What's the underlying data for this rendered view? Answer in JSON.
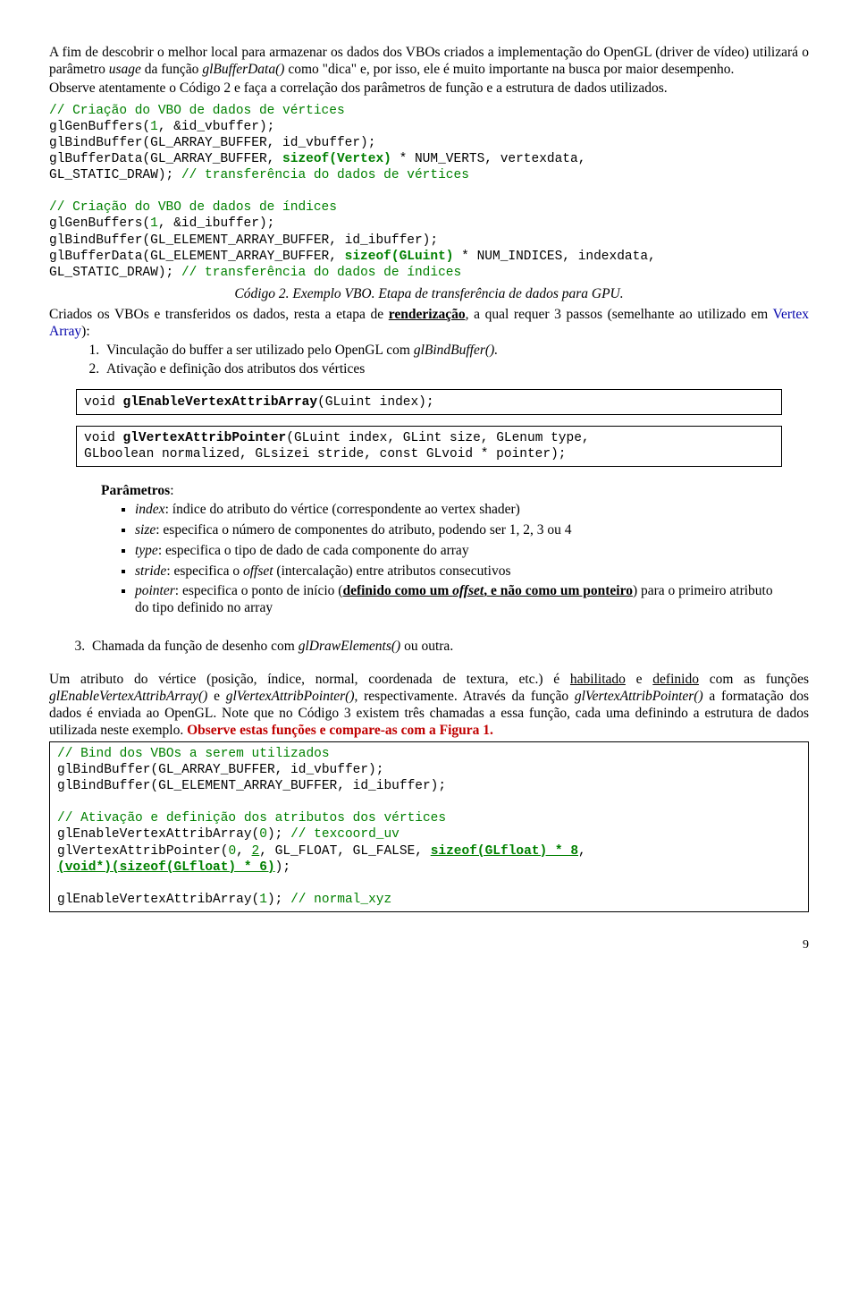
{
  "para1": "A fim de descobrir o melhor local para armazenar os dados dos VBOs criados a implementação do OpenGL (driver de vídeo) utilizará o parâmetro ",
  "para1_i1": "usage",
  "para1_b": " da função ",
  "para1_i2": "glBufferData()",
  "para1_c": " como \"dica\" e, por isso, ele é muito importante na busca por maior desempenho.",
  "para2": "Observe atentamente o Código 2 e faça a correlação dos parâmetros de função e a estrutura de dados utilizados.",
  "code1_l1": "// Criação do VBO de dados de vértices",
  "code1_l2a": "glGenBuffers(",
  "code1_l2b": "1",
  "code1_l2c": ", &id_vbuffer);",
  "code1_l3": "glBindBuffer(GL_ARRAY_BUFFER, id_vbuffer);",
  "code1_l4a": "glBufferData(GL_ARRAY_BUFFER, ",
  "code1_l4b": "sizeof(Vertex)",
  "code1_l4c": " * NUM_VERTS, vertexdata,",
  "code1_l5a": "GL_STATIC_DRAW); ",
  "code1_l5b": "// transferência do dados de vértices",
  "code2_l1": "// Criação do VBO de dados de índices",
  "code2_l2a": "glGenBuffers(",
  "code2_l2b": "1",
  "code2_l2c": ", &id_ibuffer);",
  "code2_l3": "glBindBuffer(GL_ELEMENT_ARRAY_BUFFER, id_ibuffer);",
  "code2_l4a": "glBufferData(GL_ELEMENT_ARRAY_BUFFER, ",
  "code2_l4b": "sizeof(GLuint)",
  "code2_l4c": " * NUM_INDICES, indexdata,",
  "code2_l5a": "GL_STATIC_DRAW); ",
  "code2_l5b": "// transferência do dados de índices",
  "caption1": "Código 2. Exemplo VBO. Etapa de transferência de dados para GPU.",
  "para3a": "Criados os VBOs e transferidos os dados, resta a etapa de ",
  "para3u": "renderização",
  "para3b": ", a qual requer 3 passos (semelhante ao utilizado em ",
  "para3link": "Vertex Array",
  "para3c": "):",
  "li1a": "Vinculação do buffer a ser utilizado pelo OpenGL com ",
  "li1i": "glBindBuffer().",
  "li2": "Ativação e definição dos atributos dos vértices",
  "box1a": "void ",
  "box1b": "glEnableVertexAttribArray",
  "box1c": "(GLuint index);",
  "box2a": "void ",
  "box2b": "glVertexAttribPointer",
  "box2c": "(GLuint index,  GLint size,  GLenum type,",
  "box2d": "GLboolean normalized,  GLsizei stride,  const GLvoid * pointer);",
  "params_title": "Parâmetros",
  "p_index_i": "index",
  "p_index_t": ": índice do atributo do vértice (correspondente ao vertex shader)",
  "p_size_i": "size",
  "p_size_t": ": especifica o número de componentes do atributo, podendo ser 1, 2, 3 ou 4",
  "p_type_i": "type",
  "p_type_t": ": especifica o tipo de dado de cada componente do array",
  "p_stride_i": "stride",
  "p_stride_t1": ": especifica o ",
  "p_stride_i2": "offset",
  "p_stride_t2": " (intercalação) entre atributos consecutivos",
  "p_ptr_i": "pointer",
  "p_ptr_t1": ": especifica o ponto de início (",
  "p_ptr_u1": "definido como um ",
  "p_ptr_ui": "offset",
  "p_ptr_u2": ", e não como um ponteiro",
  "p_ptr_t2": ") para o primeiro atributo do tipo definido no array",
  "li3a": "Chamada da função de desenho com ",
  "li3i": "glDrawElements()",
  "li3b": " ou outra.",
  "para4a": "Um atributo do vértice (posição, índice, normal, coordenada de textura, etc.) é ",
  "para4u1": "habilitado",
  "para4b": " e ",
  "para4u2": "definido",
  "para4c": " com as funções ",
  "para4i1": "glEnableVertexAttribArray()",
  "para4d": " e ",
  "para4i2": "glVertexAttribPointer()",
  "para4e": ", respectivamente. Através da função ",
  "para4i3": "glVertexAttribPointer()",
  "para4f": " a formatação dos dados é enviada ao OpenGL. Note que no Código 3 existem três chamadas a essa função, cada uma definindo a estrutura de dados utilizada neste exemplo. ",
  "para4red": "Observe estas funções e compare-as com a Figura 1.",
  "c3_l1": "// Bind dos VBOs a serem utilizados",
  "c3_l2": "glBindBuffer(GL_ARRAY_BUFFER, id_vbuffer);",
  "c3_l3": "glBindBuffer(GL_ELEMENT_ARRAY_BUFFER, id_ibuffer);",
  "c3_l4": "// Ativação e definição dos atributos dos vértices",
  "c3_l5a": "glEnableVertexAttribArray(",
  "c3_l5b": "0",
  "c3_l5c": "); ",
  "c3_l5d": "// texcoord_uv",
  "c3_l6a": "glVertexAttribPointer(",
  "c3_l6b": "0",
  "c3_l6c": ", ",
  "c3_l6d": "2",
  "c3_l6e": ", GL_FLOAT, GL_FALSE, ",
  "c3_l6f": "sizeof(GLfloat) * 8",
  "c3_l6g": ",",
  "c3_l7a": "(void*)(sizeof(GLfloat) * 6)",
  "c3_l7b": ");",
  "c3_l8a": "glEnableVertexAttribArray(",
  "c3_l8b": "1",
  "c3_l8c": "); ",
  "c3_l8d": "// normal_xyz",
  "pagenum": "9"
}
